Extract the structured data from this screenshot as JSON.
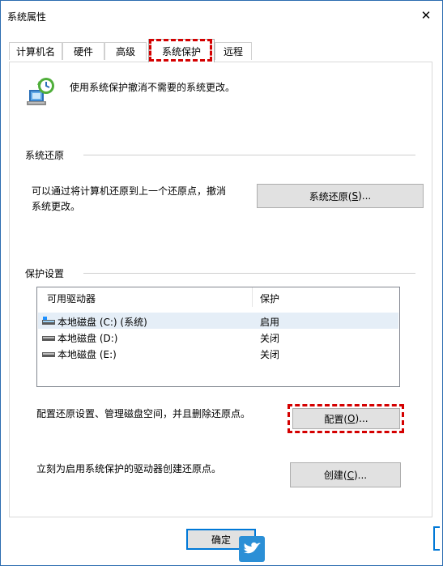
{
  "window": {
    "title": "系统属性",
    "close_label": "✕"
  },
  "tabs": [
    {
      "label": "计算机名"
    },
    {
      "label": "硬件"
    },
    {
      "label": "高级"
    },
    {
      "label": "系统保护"
    },
    {
      "label": "远程"
    }
  ],
  "intro": {
    "text": "使用系统保护撤消不需要的系统更改。",
    "icon": "system-protection-icon"
  },
  "restore": {
    "group_label": "系统还原",
    "description_line1": "可以通过将计算机还原到上一个还原点，撤消",
    "description_line2": "系统更改。",
    "button_text": "系统还原(",
    "button_accel": "S",
    "button_tail": ")..."
  },
  "protection": {
    "group_label": "保护设置",
    "col_drives": "可用驱动器",
    "col_protection": "保护",
    "drives": [
      {
        "name": "本地磁盘 (C:) (系统)",
        "protection": "启用",
        "icon": "system-drive-icon"
      },
      {
        "name": "本地磁盘 (D:)",
        "protection": "关闭",
        "icon": "drive-icon"
      },
      {
        "name": "本地磁盘 (E:)",
        "protection": "关闭",
        "icon": "drive-icon"
      }
    ],
    "configure_text": "配置还原设置、管理磁盘空间，并且删除还原点。",
    "configure_button_text": "配置(",
    "configure_button_accel": "O",
    "configure_button_tail": ")...",
    "create_text": "立刻为启用系统保护的驱动器创建还原点。",
    "create_button_text": "创建(",
    "create_button_accel": "C",
    "create_button_tail": ")..."
  },
  "footer": {
    "ok_label": "确定"
  },
  "colors": {
    "highlight": "#d40000",
    "accent": "#0078d7",
    "selected_row": "#e5eef7"
  }
}
